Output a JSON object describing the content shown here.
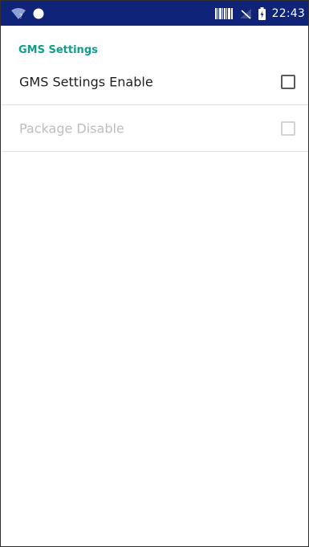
{
  "status_bar": {
    "time": "22:43",
    "icons": [
      "wifi-question-icon",
      "circle-icon",
      "barcode-icon",
      "no-signal-icon",
      "battery-charging-icon"
    ],
    "background_color": "#0f2378"
  },
  "settings": {
    "category_title": "GMS Settings",
    "accent_color": "#129c8a",
    "items": [
      {
        "label": "GMS Settings Enable",
        "checked": false,
        "enabled": true
      },
      {
        "label": "Package Disable",
        "checked": false,
        "enabled": false
      }
    ]
  }
}
